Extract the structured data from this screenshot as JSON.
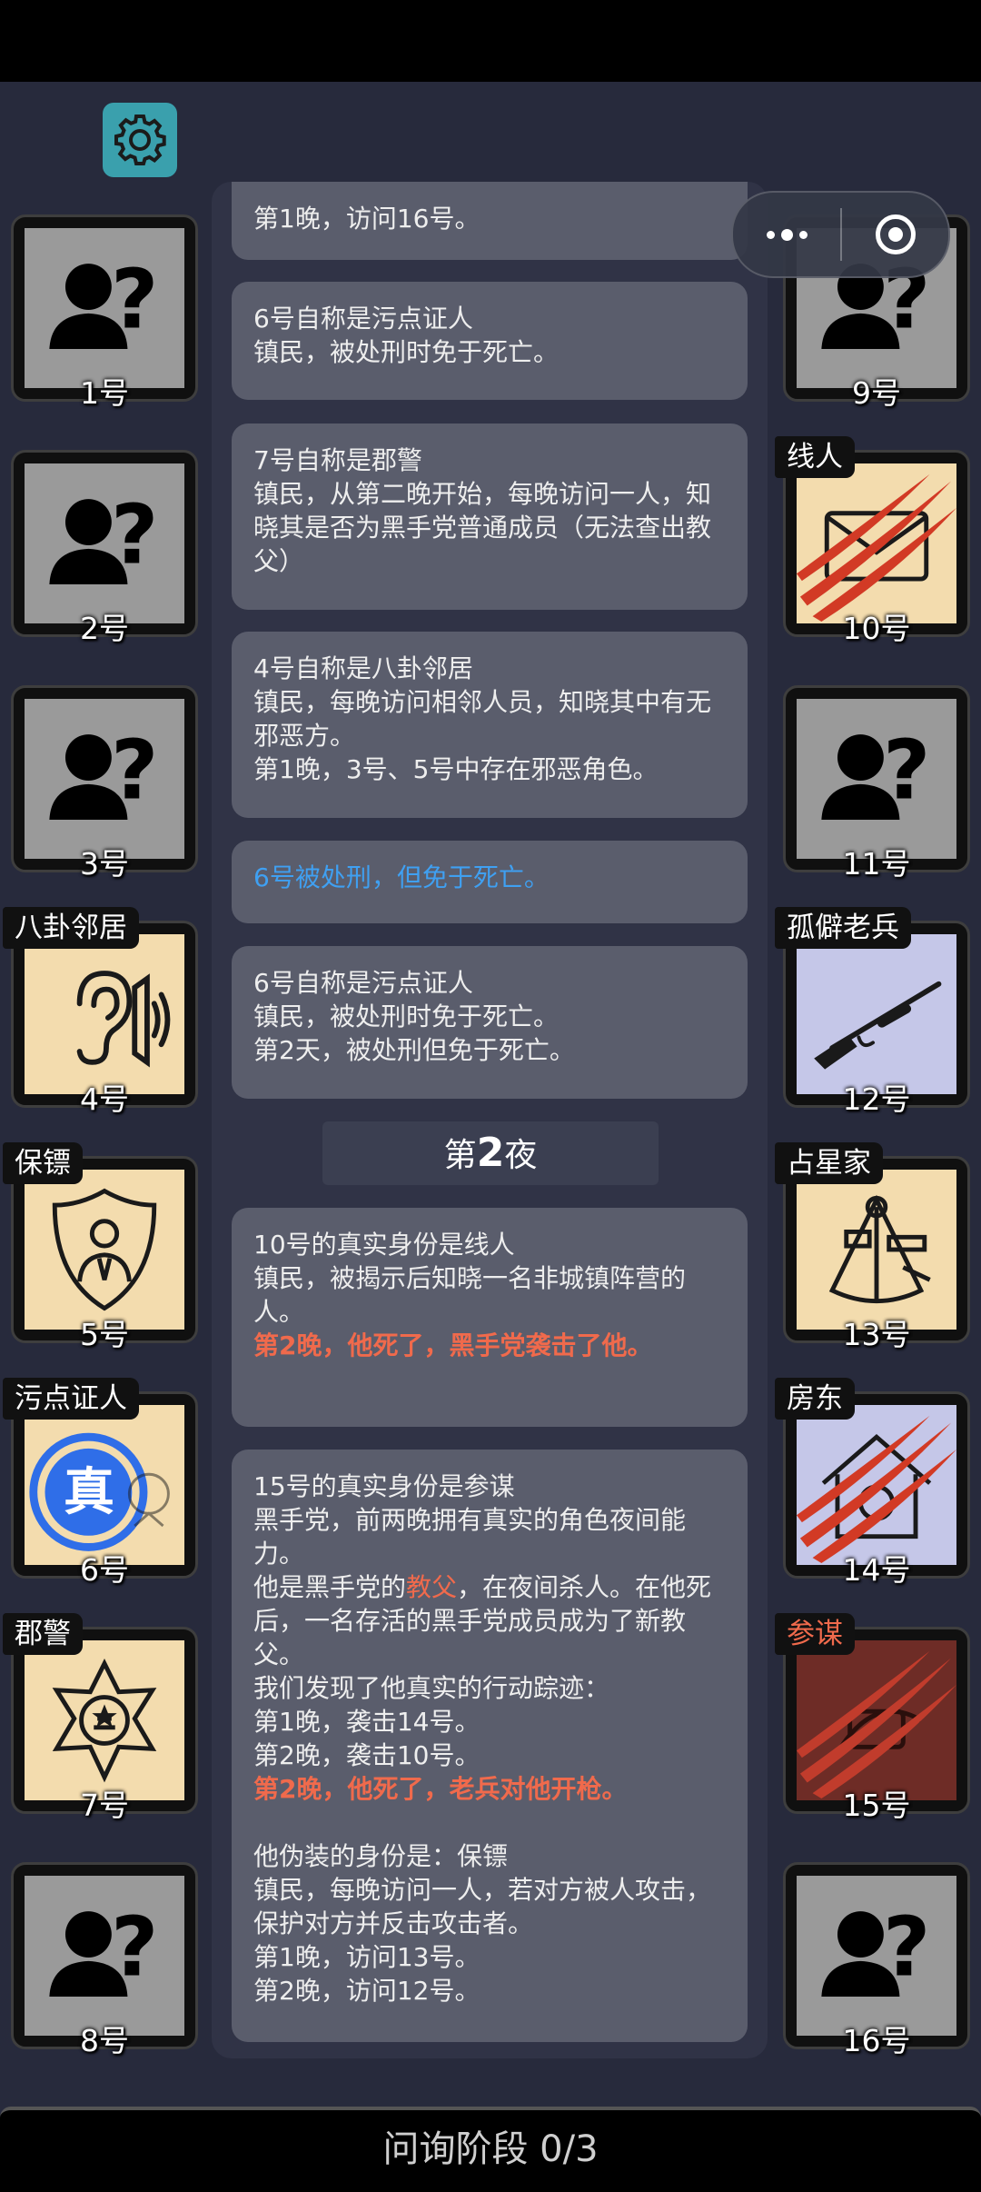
{
  "header": {
    "settings_icon": "gear-icon"
  },
  "capsule": {
    "menu_icon": "more-dots-icon",
    "record_icon": "record-icon"
  },
  "left_players": [
    {
      "num": "1号",
      "role": "",
      "avatar": "unknown-person-icon"
    },
    {
      "num": "2号",
      "role": "",
      "avatar": "unknown-person-icon"
    },
    {
      "num": "3号",
      "role": "",
      "avatar": "unknown-person-icon"
    },
    {
      "num": "4号",
      "role": "八卦邻居",
      "avatar": "ear-sound-icon"
    },
    {
      "num": "5号",
      "role": "保镖",
      "avatar": "bodyguard-shield-icon"
    },
    {
      "num": "6号",
      "role": "污点证人",
      "avatar": "true-stamp-icon",
      "stamp": "真"
    },
    {
      "num": "7号",
      "role": "郡警",
      "avatar": "sheriff-badge-icon"
    },
    {
      "num": "8号",
      "role": "",
      "avatar": "unknown-person-icon"
    }
  ],
  "right_players": [
    {
      "num": "9号",
      "role": "",
      "avatar": "unknown-person-icon"
    },
    {
      "num": "10号",
      "role": "线人",
      "avatar": "envelope-claw-icon"
    },
    {
      "num": "11号",
      "role": "",
      "avatar": "unknown-person-icon"
    },
    {
      "num": "12号",
      "role": "孤僻老兵",
      "avatar": "rifle-icon"
    },
    {
      "num": "13号",
      "role": "占星家",
      "avatar": "sextant-icon"
    },
    {
      "num": "14号",
      "role": "房东",
      "avatar": "house-claw-icon"
    },
    {
      "num": "15号",
      "role": "参谋",
      "avatar": "claw-icon"
    },
    {
      "num": "16号",
      "role": "",
      "avatar": "unknown-person-icon"
    }
  ],
  "log": {
    "card0": {
      "line1": "第1晚，访问16号。"
    },
    "card1": {
      "line1": "6号自称是污点证人",
      "line2": "镇民，被处刑时免于死亡。"
    },
    "card2": {
      "line1": "7号自称是郡警",
      "line2": "镇民，从第二晚开始，每晚访问一人，知晓其是否为黑手党普通成员（无法查出教父）"
    },
    "card3": {
      "line1": "4号自称是八卦邻居",
      "line2": "镇民，每晚访问相邻人员，知晓其中有无邪恶方。",
      "line3": "第1晚，3号、5号中存在邪恶角色。"
    },
    "card4": {
      "line1": "6号被处刑，但免于死亡。"
    },
    "card5": {
      "line1": "6号自称是污点证人",
      "line2": "镇民，被处刑时免于死亡。",
      "line3": "第2天，被处刑但免于死亡。"
    },
    "night": {
      "prefix": "第",
      "number": "2",
      "suffix": "夜"
    },
    "card6": {
      "line1": "10号的真实身份是线人",
      "line2": "镇民，被揭示后知晓一名非城镇阵营的人。",
      "line3": "第2晚，他死了，黑手党袭击了他。"
    },
    "card7": {
      "line1": "15号的真实身份是参谋",
      "line2": "黑手党，前两晚拥有真实的角色夜间能力。",
      "line3a": "他是黑手党的",
      "line3b": "教父",
      "line3c": "，在夜间杀人。在他死后，一名存活的黑手党成员成为了新教父。",
      "line4": "我们发现了他真实的行动踪迹：",
      "line5": "第1晚，袭击14号。",
      "line6": "第2晚，袭击10号。",
      "line7": "第2晚，他死了，老兵对他开枪。",
      "line8": "他伪装的身份是：保镖",
      "line9": "镇民，每晚访问一人，若对方被人攻击，保护对方并反击攻击者。",
      "line10": "第1晚，访问13号。",
      "line11": "第2晚，访问12号。"
    }
  },
  "footer": {
    "phase": "问询阶段 0/3"
  },
  "colors": {
    "background": "#272a3c",
    "card": "#5a5d6c",
    "accent_red": "#f06a4c",
    "accent_blue": "#3fa0f2",
    "settings": "#3aa0ad"
  }
}
